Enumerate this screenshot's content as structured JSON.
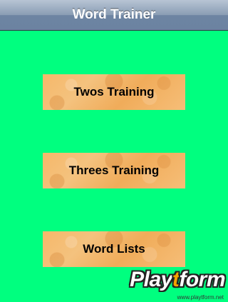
{
  "navbar": {
    "title": "Word Trainer"
  },
  "menu": {
    "twos_label": "Twos Training",
    "threes_label": "Threes Training",
    "lists_label": "Word Lists"
  },
  "watermark": {
    "logo_part1": "Play",
    "logo_accent": "t",
    "logo_part2": "form",
    "url": "www.playtform.net"
  },
  "colors": {
    "background": "#00ff7f",
    "button": "#f4b86c",
    "navbar": "#8a9db4"
  }
}
